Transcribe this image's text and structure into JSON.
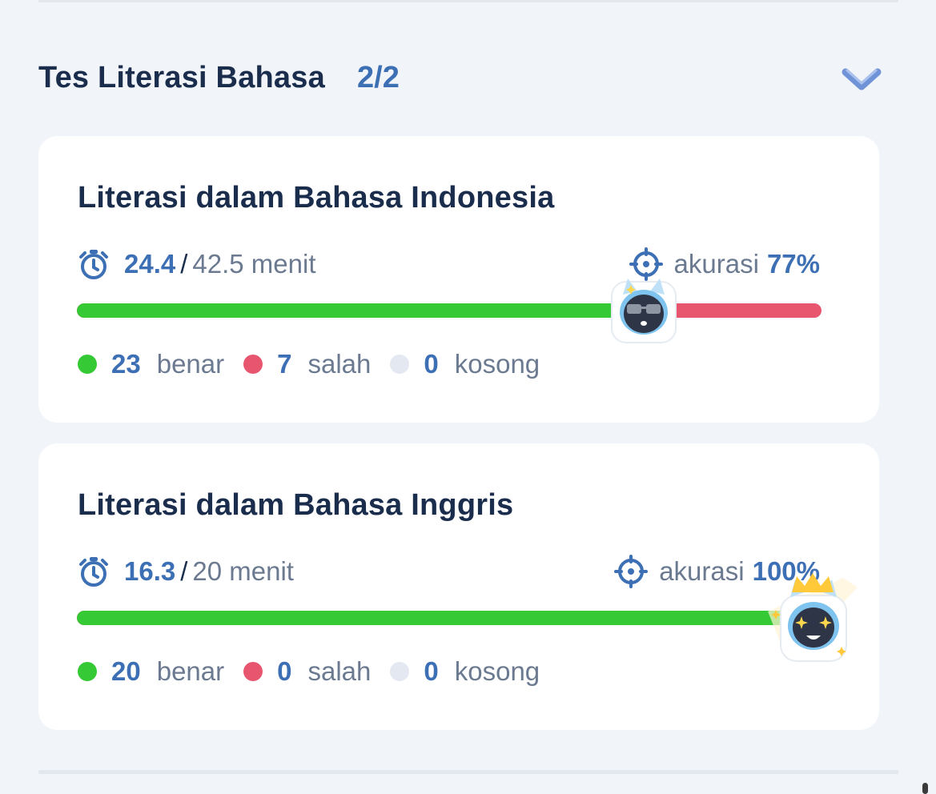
{
  "section": {
    "title": "Tes Literasi Bahasa",
    "count": "2/2",
    "toggle_icon": "chevron-down-icon"
  },
  "cards": [
    {
      "title": "Literasi dalam Bahasa Indonesia",
      "time_used": "24.4",
      "time_separator": "/",
      "time_total": "42.5 menit",
      "accuracy_label": "akurasi",
      "accuracy_value": "77%",
      "progress_fraction": 0.77,
      "correct": "23",
      "correct_label": "benar",
      "wrong": "7",
      "wrong_label": "salah",
      "empty": "0",
      "empty_label": "kosong",
      "mascot": "sunglasses-mascot-icon"
    },
    {
      "title": "Literasi dalam Bahasa Inggris",
      "time_used": "16.3",
      "time_separator": "/",
      "time_total": "20 menit",
      "accuracy_label": "akurasi",
      "accuracy_value": "100%",
      "progress_fraction": 1.0,
      "correct": "20",
      "correct_label": "benar",
      "wrong": "0",
      "wrong_label": "salah",
      "empty": "0",
      "empty_label": "kosong",
      "mascot": "crown-mascot-icon"
    }
  ],
  "colors": {
    "correct": "#35c935",
    "wrong": "#e7556f",
    "empty": "#e3e8f1",
    "accent": "#3d6fb5",
    "title": "#1b2d4d"
  }
}
